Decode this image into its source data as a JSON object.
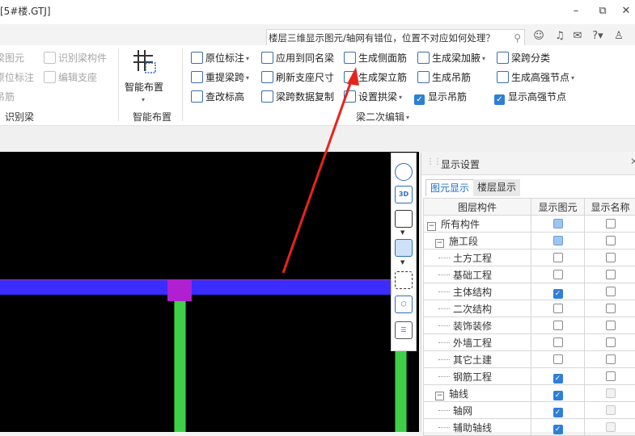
{
  "window": {
    "title": "[5#楼.GTJ]",
    "controls": [
      "–",
      "⧉",
      "✕"
    ]
  },
  "search": {
    "text": "楼层三维显示图元/轴网有错位，位置不对应如何处理？",
    "icon": "search-icon"
  },
  "top_icons": [
    "user-icon",
    "headset-icon",
    "message-icon",
    "help-icon",
    "shirt-icon"
  ],
  "ribbon": {
    "left_partial": [
      "梁图元",
      "识别梁构件",
      "原位标注",
      "编辑支座",
      "吊筋"
    ],
    "left_group": "识别梁",
    "smart_layout": {
      "label": "智能布置",
      "group": "智能布置"
    },
    "buttons": {
      "yuanwei": "原位标注",
      "apply_same": "应用到同名梁",
      "gen_side": "生成侧面筋",
      "gen_haunch": "生成梁加腋",
      "span_classify": "梁跨分类",
      "relift": "重提梁跨",
      "refresh": "刷新支座尺寸",
      "gen_erect": "生成架立筋",
      "gen_hanger": "生成吊筋",
      "gen_high_node": "生成高强节点",
      "check_elev": "查改标高",
      "copy_span": "梁跨数据复制",
      "set_arch": "设置拱梁",
      "show_hanger": "显示吊筋",
      "show_high_node": "显示高强节点"
    },
    "edit_group": "梁二次编辑"
  },
  "panel": {
    "title": "显示设置",
    "tabs": [
      "图元显示",
      "楼层显示"
    ],
    "columns": [
      "图层构件",
      "显示图元",
      "显示名称"
    ],
    "rows": [
      {
        "label": "所有构件",
        "level": 0,
        "toggle": "−",
        "show": "partial",
        "name": "off"
      },
      {
        "label": "施工段",
        "level": 1,
        "toggle": "−",
        "show": "partial",
        "name": "off"
      },
      {
        "label": "土方工程",
        "level": 2,
        "show": "off",
        "name": "off"
      },
      {
        "label": "基础工程",
        "level": 2,
        "show": "off",
        "name": "off"
      },
      {
        "label": "主体结构",
        "level": 2,
        "show": "on",
        "name": "off"
      },
      {
        "label": "二次结构",
        "level": 2,
        "show": "off",
        "name": "off"
      },
      {
        "label": "装饰装修",
        "level": 2,
        "show": "off",
        "name": "off"
      },
      {
        "label": "外墙工程",
        "level": 2,
        "show": "off",
        "name": "off"
      },
      {
        "label": "其它土建",
        "level": 2,
        "show": "off",
        "name": "off"
      },
      {
        "label": "钢筋工程",
        "level": 2,
        "show": "on",
        "name": "off"
      },
      {
        "label": "轴线",
        "level": 1,
        "toggle": "−",
        "show": "on",
        "name": "dim"
      },
      {
        "label": "轴网",
        "level": 2,
        "show": "on",
        "name": "dim"
      },
      {
        "label": "辅助轴线",
        "level": 2,
        "show": "on",
        "name": "dim"
      }
    ]
  },
  "view_toolbar": [
    "orbit-icon",
    "3d-view-icon",
    "cube-view-icon",
    "cube-solid-icon",
    "select-frame-icon",
    "component-view-icon",
    "settings-list-icon"
  ],
  "colors": {
    "beam": "#3b2cff",
    "column": "#3fd04a",
    "column_head": "#b01fd0",
    "arrow": "#e8231e",
    "accent": "#2f7fd8"
  }
}
